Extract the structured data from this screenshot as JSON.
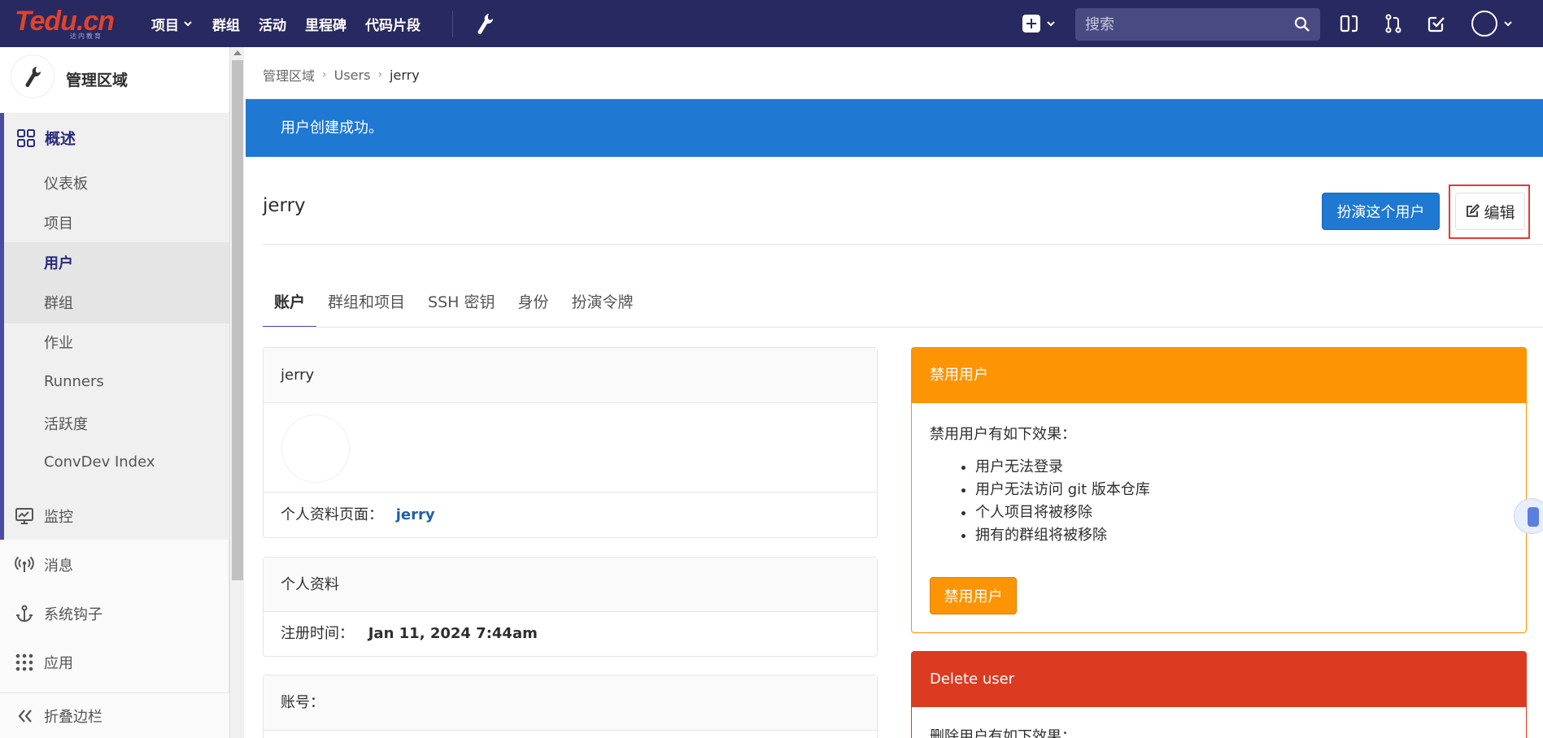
{
  "navbar": {
    "logo_text": "Tedu.cn",
    "logo_sub": "达内教育",
    "links": [
      "项目",
      "群组",
      "活动",
      "里程碑",
      "代码片段"
    ],
    "search_placeholder": "搜索"
  },
  "sidebar": {
    "header_title": "管理区域",
    "overview_label": "概述",
    "sub_items": [
      "仪表板",
      "项目",
      "用户",
      "群组",
      "作业",
      "Runners",
      "活跃度",
      "ConvDev Index"
    ],
    "monitor": "监控",
    "messages": "消息",
    "hooks": "系统钩子",
    "apps": "应用",
    "collapse": "折叠边栏"
  },
  "breadcrumb": {
    "items": [
      "管理区域",
      "Users",
      "jerry"
    ]
  },
  "flash": "用户创建成功。",
  "user": {
    "title": "jerry",
    "impersonate_label": "扮演这个用户",
    "edit_label": "编辑"
  },
  "tabs": [
    "账户",
    "群组和项目",
    "SSH 密钥",
    "身份",
    "扮演令牌"
  ],
  "cards": {
    "name_head": "jerry",
    "profile_page_label": "个人资料页面：",
    "profile_page_link": "jerry",
    "profile_head": "个人资料",
    "registered_label": "注册时间：",
    "registered_value": "Jan 11, 2024 7:44am",
    "account_label": "账号："
  },
  "block_panel": {
    "title": "禁用用户",
    "intro": "禁用用户有如下效果：",
    "effects": [
      "用户无法登录",
      "用户无法访问 git 版本仓库",
      "个人项目将被移除",
      "拥有的群组将被移除"
    ],
    "button": "禁用用户"
  },
  "delete_panel": {
    "title": "Delete user",
    "intro": "删除用户有如下效果："
  },
  "colors": {
    "navbar": "#292961",
    "primary": "#1f78d1",
    "warning": "#fc9403",
    "danger": "#db3b21"
  }
}
